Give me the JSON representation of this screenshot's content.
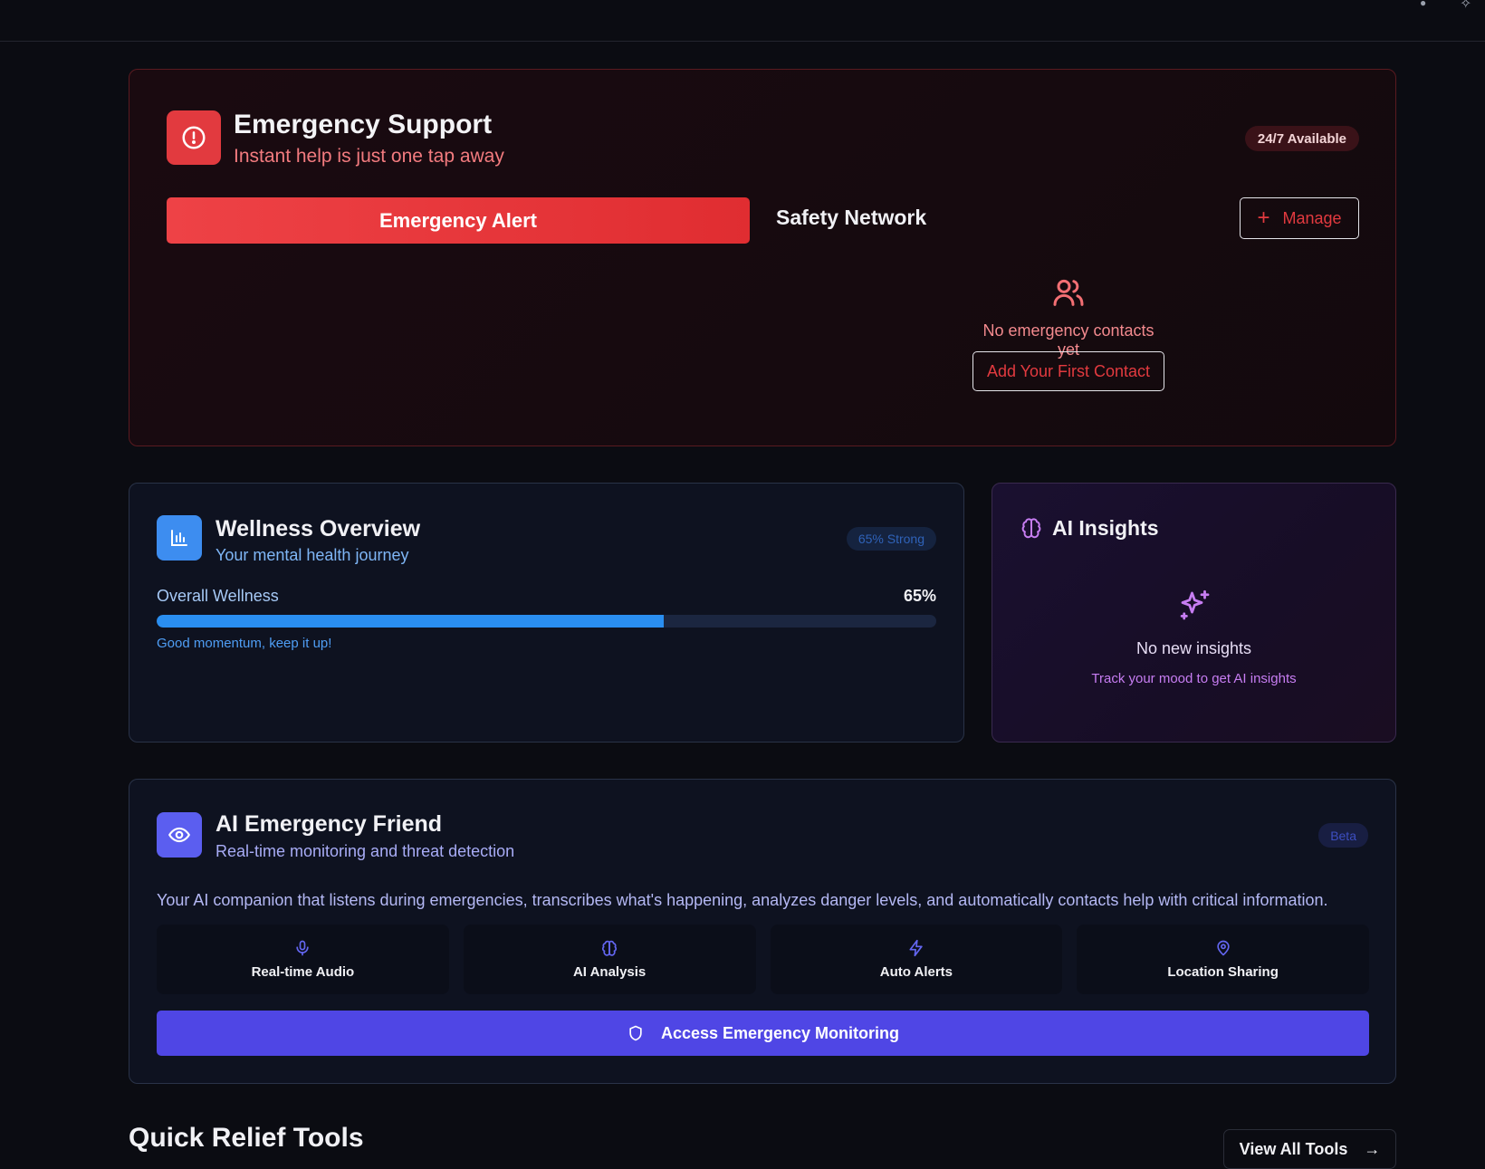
{
  "emergency": {
    "title": "Emergency Support",
    "subtitle": "Instant help is just one tap away",
    "badge": "24/7 Available",
    "alert_button": "Emergency Alert",
    "network_title": "Safety Network",
    "manage_button": "Manage",
    "empty_text": "No emergency contacts yet",
    "add_contact_button": "Add Your First Contact"
  },
  "wellness": {
    "title": "Wellness Overview",
    "subtitle": "Your mental health journey",
    "badge": "65% Strong",
    "label": "Overall Wellness",
    "value": "65%",
    "progress": 0.65,
    "note": "Good momentum, keep it up!"
  },
  "insights": {
    "title": "AI Insights",
    "empty_title": "No new insights",
    "empty_hint": "Track your mood to get AI insights"
  },
  "friend": {
    "title": "AI Emergency Friend",
    "subtitle": "Real-time monitoring and threat detection",
    "badge": "Beta",
    "description": "Your AI companion that listens during emergencies, transcribes what's happening, analyzes danger levels, and automatically contacts help with critical information.",
    "features": [
      {
        "label": "Real-time Audio",
        "icon": "mic-icon"
      },
      {
        "label": "AI Analysis",
        "icon": "brain-icon"
      },
      {
        "label": "Auto Alerts",
        "icon": "bolt-icon"
      },
      {
        "label": "Location Sharing",
        "icon": "map-pin-icon"
      }
    ],
    "cta": "Access Emergency Monitoring"
  },
  "quick_relief": {
    "title": "Quick Relief Tools",
    "view_all": "View All Tools"
  },
  "colors": {
    "danger": "#e23a3f",
    "wellness_blue": "#2a8ef0",
    "insights_purple": "#c77df2",
    "friend_indigo": "#4f46e5"
  }
}
